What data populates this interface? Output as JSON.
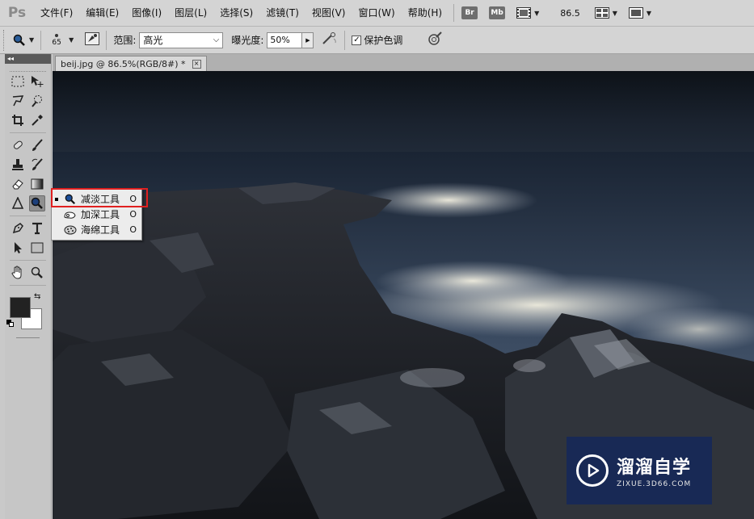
{
  "app": {
    "logo": "Ps"
  },
  "menu": {
    "items": [
      "文件(F)",
      "编辑(E)",
      "图像(I)",
      "图层(L)",
      "选择(S)",
      "滤镜(T)",
      "视图(V)",
      "窗口(W)",
      "帮助(H)"
    ],
    "bridge_label": "Br",
    "mini_bridge_label": "Mb",
    "zoom": "86.5"
  },
  "options": {
    "brush_size": "65",
    "range_label": "范围:",
    "range_value": "高光",
    "exposure_label": "曝光度:",
    "exposure_value": "50%",
    "protect_tones_label": "保护色调",
    "protect_tones_checked": "✓"
  },
  "toolbox": {
    "collapse_label": "◂◂"
  },
  "document": {
    "tab_title": "beij.jpg @ 86.5%(RGB/8#) *",
    "close_glyph": "×"
  },
  "flyout": {
    "items": [
      {
        "label": "减淡工具",
        "key": "O",
        "icon": "dodge-icon",
        "selected": true
      },
      {
        "label": "加深工具",
        "key": "O",
        "icon": "burn-icon",
        "selected": false
      },
      {
        "label": "海绵工具",
        "key": "O",
        "icon": "sponge-icon",
        "selected": false
      }
    ]
  },
  "colors": {
    "highlight_border": "#e02020",
    "foreground": "#222222",
    "background": "#ffffff",
    "watermark_bg": "#14285a"
  },
  "watermark": {
    "brand": "溜溜自学",
    "url": "ZIXUE.3D66.COM"
  }
}
